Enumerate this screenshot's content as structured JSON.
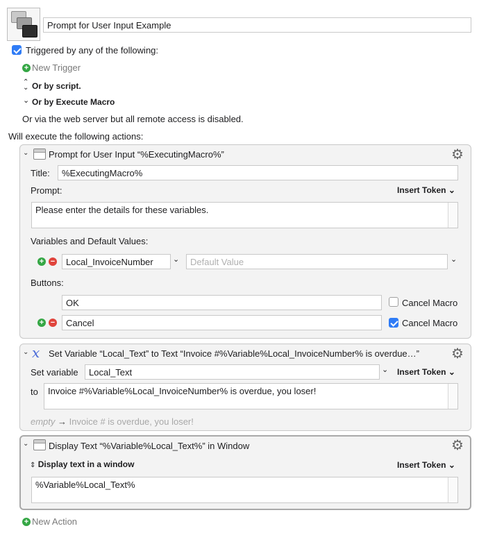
{
  "macro": {
    "name": "Prompt for User Input Example",
    "triggered_label": "Triggered by any of the following:",
    "new_trigger": "New Trigger",
    "or_by_script": "Or by script.",
    "or_by_execute": "Or by Execute Macro",
    "web_server_note": "Or via the web server but all remote access is disabled.",
    "will_execute": "Will execute the following actions:",
    "new_action": "New Action"
  },
  "action1": {
    "title": "Prompt for User Input “%ExecutingMacro%”",
    "title_label": "Title:",
    "title_value": "%ExecutingMacro%",
    "prompt_label": "Prompt:",
    "insert_token": "Insert Token",
    "prompt_value": "Please enter the details for these variables.",
    "vars_label": "Variables and Default Values:",
    "var_name": "Local_InvoiceNumber",
    "default_placeholder": "Default Value",
    "buttons_label": "Buttons:",
    "button1": "OK",
    "button2": "Cancel",
    "cancel_macro": "Cancel Macro",
    "button1_cancel": false,
    "button2_cancel": true
  },
  "action2": {
    "title": "Set Variable “Local_Text” to Text “Invoice #%Variable%Local_InvoiceNumber% is overdue…”",
    "set_label": "Set variable",
    "var_name": "Local_Text",
    "insert_token": "Insert Token",
    "to_label": "to",
    "to_value": "Invoice #%Variable%Local_InvoiceNumber% is overdue, you loser!",
    "preview_empty": "empty",
    "preview_arrow": "→",
    "preview_result": "Invoice # is overdue, you loser!"
  },
  "action3": {
    "title": "Display Text “%Variable%Local_Text%” in Window",
    "mode": "Display text in a window",
    "insert_token": "Insert Token",
    "text_value": "%Variable%Local_Text%"
  }
}
